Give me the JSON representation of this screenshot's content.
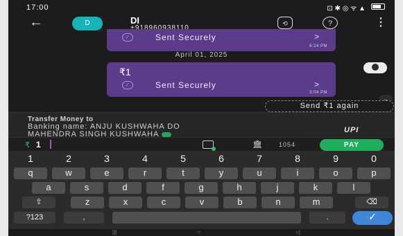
{
  "status": {
    "time": "17:00",
    "icons": "⊡ ✱ ◎ ᯤ ▲"
  },
  "header": {
    "avatar_letter": "D",
    "name": "DI",
    "phone": "+918960938110",
    "history_icon": "clock-history-icon",
    "help_icon": "help-icon",
    "more_icon": "more-vertical-icon"
  },
  "chat": {
    "messages": [
      {
        "status": "Sent Securely",
        "time": "6:24 PM"
      },
      {
        "amount": "₹1",
        "status": "Sent Securely",
        "time": "3:04 PM"
      }
    ],
    "date_separator": "April 01, 2025",
    "send_chip": "Send ₹1 again"
  },
  "transfer": {
    "title": "Transfer Money to",
    "line1": "Banking name: ANJU KUSHWAHA DO",
    "line2": "MAHENDRA SINGH KUSHWAHA",
    "upi": "UPI"
  },
  "amount_bar": {
    "currency": "₹",
    "value": "1",
    "bank_digits": "1054",
    "pay_label": "PAY"
  },
  "keyboard": {
    "numbers": [
      "1",
      "2",
      "3",
      "4",
      "5",
      "6",
      "7",
      "8",
      "9",
      "0"
    ],
    "row1": [
      "q",
      "w",
      "e",
      "r",
      "t",
      "y",
      "u",
      "i",
      "o",
      "p"
    ],
    "row2": [
      "a",
      "s",
      "d",
      "f",
      "g",
      "h",
      "j",
      "k",
      "l"
    ],
    "row3": [
      "z",
      "x",
      "c",
      "v",
      "b",
      "n",
      "m"
    ],
    "symbols_label": "?123",
    "comma": ",",
    "period": "."
  },
  "colors": {
    "bubble": "#5b3c8b",
    "pay": "#1fae5b",
    "accent": "#16b3b9"
  }
}
